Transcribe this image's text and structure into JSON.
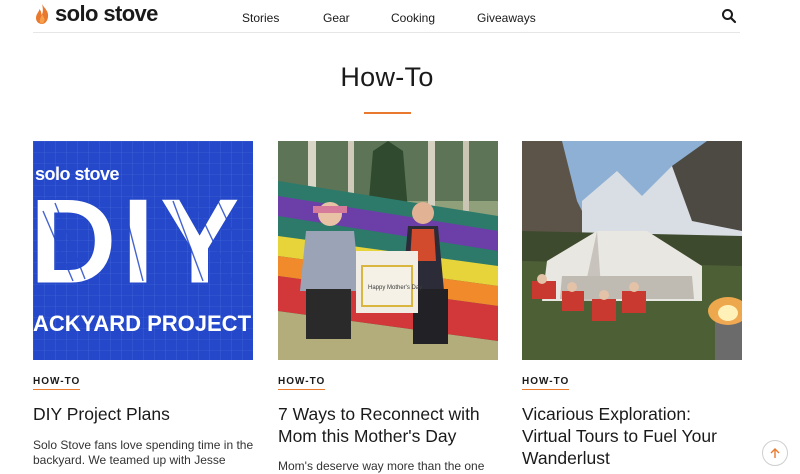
{
  "header": {
    "logo_text": "solo stove",
    "nav": [
      {
        "label": "Stories"
      },
      {
        "label": "Gear"
      },
      {
        "label": "Cooking"
      },
      {
        "label": "Giveaways"
      }
    ],
    "search_icon": "search-icon"
  },
  "page": {
    "title": "How-To",
    "accent_color": "#e8792e"
  },
  "cards": [
    {
      "tag": "HOW-TO",
      "title": "DIY Project Plans",
      "excerpt": "Solo Stove fans love spending time in the backyard. We teamed up with Jesse",
      "image": {
        "brand": "solo stove",
        "big_text": "DIY",
        "banner_text": "ACKYARD PROJECT"
      }
    },
    {
      "tag": "HOW-TO",
      "title": "7 Ways to Reconnect with Mom this Mother's Day",
      "excerpt": "Mom's deserve way more than the one",
      "image": {
        "box_text": "Happy Mother's Day"
      }
    },
    {
      "tag": "HOW-TO",
      "title": "Vicarious Exploration: Virtual Tours to Fuel Your Wanderlust",
      "excerpt": ""
    }
  ],
  "scroll_top_icon": "arrow-up-icon"
}
